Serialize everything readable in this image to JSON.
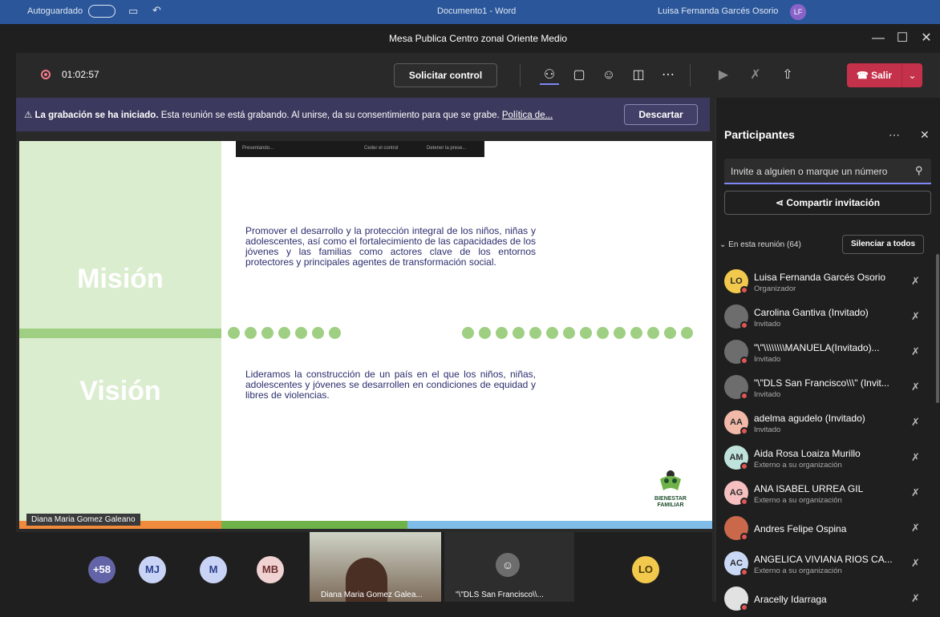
{
  "word": {
    "autosave": "Autoguardado",
    "doc_title": "Documento1 - Word",
    "user": "Luisa Fernanda Garcés Osorio",
    "user_initials": "LF"
  },
  "window": {
    "title": "Mesa Publica Centro zonal Oriente Medio"
  },
  "toolbar": {
    "recording_time": "01:02:57",
    "request_control": "Solicitar control",
    "leave": "Salir"
  },
  "banner": {
    "bold": "La grabación se ha iniciado.",
    "text": "Esta reunión se está grabando. Al unirse, da su consentimiento para que se grabe.",
    "link": "Política de...",
    "dismiss": "Descartar"
  },
  "slide": {
    "mission_title": "Misión",
    "vision_title": "Visión",
    "mission_text": "Promover el desarrollo y la protección integral de los niños, niñas y adolescentes, así como el fortalecimiento de las capacidades de los jóvenes y las familias como actores clave de los entornos protectores y principales agentes de transformación social.",
    "vision_text": "Lideramos la construcción de un país en el que los niños, niñas, adolescentes y jóvenes se desarrollen en condiciones de equidad y libres de violencias.",
    "logo_line1": "BIENESTAR",
    "logo_line2": "FAMILIAR",
    "presenter_bar": [
      "Presentando...",
      "Ceder el control",
      "Detener la prese..."
    ]
  },
  "presenter_name": "Diana Maria Gomez Galeano",
  "roster": {
    "overflow": "+58",
    "avatars": [
      "MJ",
      "M",
      "MB"
    ],
    "tile1": "Diana Maria Gomez Galea...",
    "tile2": "\"\\\"DLS San Francisco\\\\...",
    "last_avatar": "LO"
  },
  "panel": {
    "title": "Participantes",
    "search_placeholder": "Invite a alguien o marque un número",
    "share": "Compartir invitación",
    "section": "En esta reunión (64)",
    "mute_all": "Silenciar a todos",
    "participants": [
      {
        "initials": "LO",
        "name": "Luisa Fernanda Garcés Osorio",
        "role": "Organizador",
        "color": "#f2c94c"
      },
      {
        "initials": "",
        "name": "Carolina Gantiva (Invitado)",
        "role": "Invitado",
        "color": "#6d6d6d"
      },
      {
        "initials": "",
        "name": "\"\\\"\\\\\\\\\\\\\\\\MANUELA(Invitado)...",
        "role": "Invitado",
        "color": "#6d6d6d"
      },
      {
        "initials": "",
        "name": "\"\\\"DLS San Francisco\\\\\\\" (Invit...",
        "role": "Invitado",
        "color": "#6d6d6d"
      },
      {
        "initials": "AA",
        "name": "adelma agudelo (Invitado)",
        "role": "Invitado",
        "color": "#f3b9a8"
      },
      {
        "initials": "AM",
        "name": "Aida Rosa Loaiza Murillo",
        "role": "Externo a su organización",
        "color": "#bfe3dc"
      },
      {
        "initials": "AG",
        "name": "ANA ISABEL URREA GIL",
        "role": "Externo a su organización",
        "color": "#f7c0c0"
      },
      {
        "initials": "",
        "name": "Andres Felipe Ospina",
        "role": "",
        "color": "#c9684a"
      },
      {
        "initials": "AC",
        "name": "ANGELICA VIVIANA RIOS CA...",
        "role": "Externo a su organización",
        "color": "#c9d8f5"
      },
      {
        "initials": "",
        "name": "Aracelly Idarraga",
        "role": "",
        "color": "#e2e2e2"
      }
    ]
  }
}
